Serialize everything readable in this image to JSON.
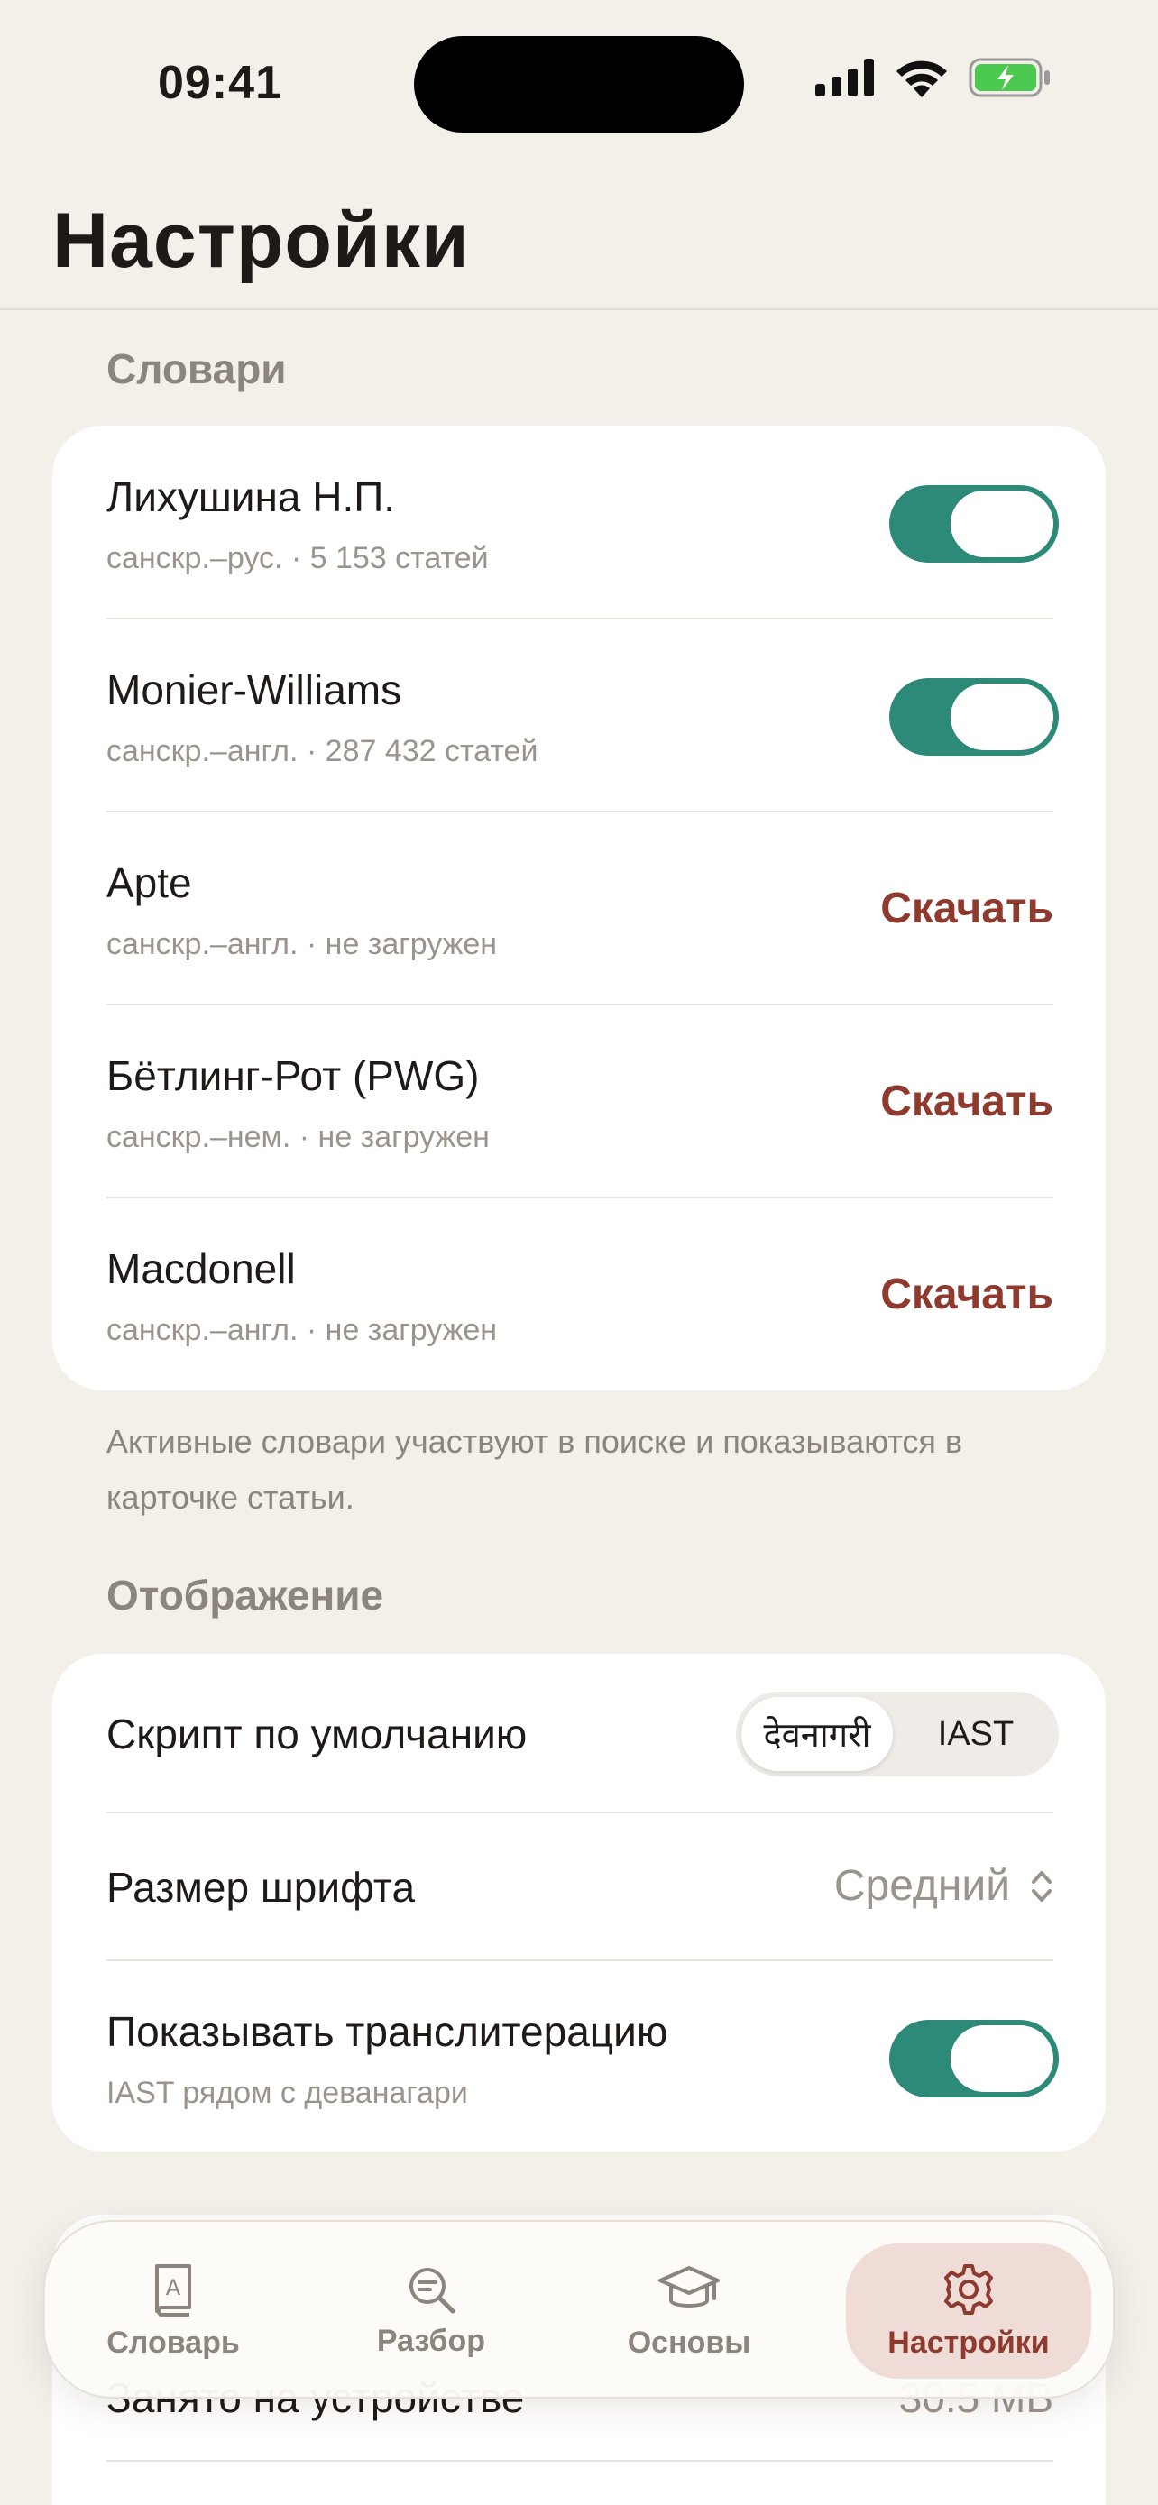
{
  "status_bar": {
    "time": "09:41"
  },
  "header": {
    "title": "Настройки"
  },
  "dictionaries": {
    "section_title": "Словари",
    "items": [
      {
        "title": "Лихушина Н.П.",
        "subtitle": "санскр.–рус. · 5 153 статей",
        "state": "on"
      },
      {
        "title": "Monier-Williams",
        "subtitle": "санскр.–англ. · 287 432 статей",
        "state": "on"
      },
      {
        "title": "Apte",
        "subtitle": "санскр.–англ. · не загружен",
        "action": "Скачать"
      },
      {
        "title": "Бётлинг-Рот (PWG)",
        "subtitle": "санскр.–нем. · не загружен",
        "action": "Скачать"
      },
      {
        "title": "Macdonell",
        "subtitle": "санскр.–англ. · не загружен",
        "action": "Скачать"
      }
    ],
    "footnote": "Активные словари участвуют в поиске и показываются в карточке статьи."
  },
  "display": {
    "section_title": "Отображение",
    "script_label": "Скрипт по умолчанию",
    "script_options": [
      "देवनागरी",
      "IAST"
    ],
    "script_selected": "देवनागरी",
    "font_size_label": "Размер шрифта",
    "font_size_value": "Средний",
    "translit_label": "Показывать транслитерацию",
    "translit_sub": "IAST рядом с деванагари",
    "translit_state": "on"
  },
  "storage": {
    "row_label": "Занято на устройстве",
    "row_value": "30.5 MB"
  },
  "tab_bar": {
    "tabs": [
      {
        "label": "Словарь",
        "icon": "book-icon"
      },
      {
        "label": "Разбор",
        "icon": "magnifier-text-icon"
      },
      {
        "label": "Основы",
        "icon": "graduation-cap-icon"
      },
      {
        "label": "Настройки",
        "icon": "gear-icon"
      }
    ],
    "active": "Настройки"
  },
  "colors": {
    "background": "#f3efe9",
    "accent_green": "#2e8a78",
    "accent_red": "#8e3a2e",
    "secondary_text": "#9b948c"
  }
}
